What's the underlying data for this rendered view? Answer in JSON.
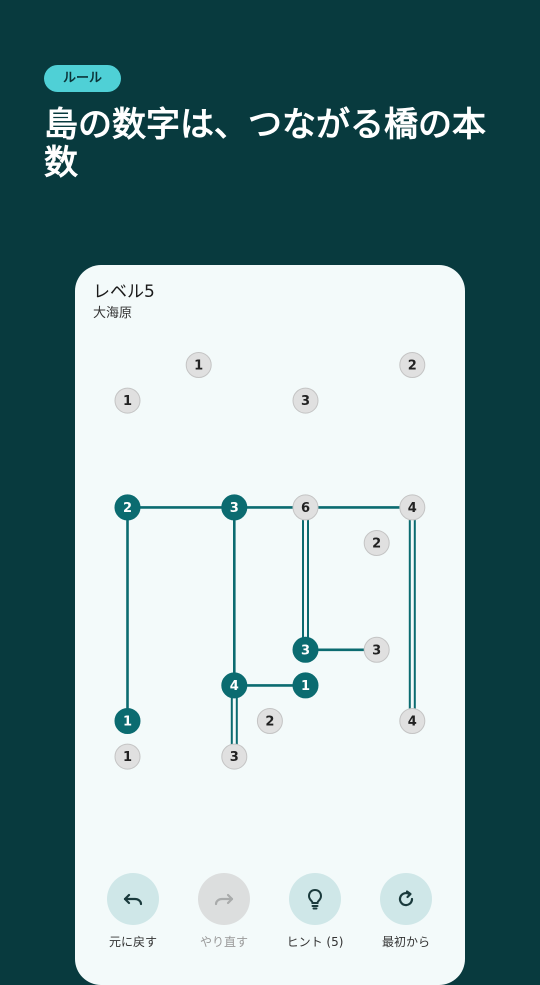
{
  "header": {
    "badge": "ルール",
    "headline": "島の数字は、つながる橋の本数"
  },
  "puzzle": {
    "level": "レベル5",
    "subtitle": "大海原",
    "colors": {
      "complete": "#0b6b70",
      "incomplete": "#e0e0e0",
      "bridge": "#0b6b70"
    },
    "islands": [
      {
        "id": "a",
        "col": 2,
        "row": 0,
        "n": "1",
        "state": "incomplete"
      },
      {
        "id": "b",
        "col": 8,
        "row": 0,
        "n": "2",
        "state": "incomplete"
      },
      {
        "id": "c",
        "col": 0,
        "row": 1,
        "n": "1",
        "state": "incomplete"
      },
      {
        "id": "d",
        "col": 5,
        "row": 1,
        "n": "3",
        "state": "incomplete"
      },
      {
        "id": "e",
        "col": 0,
        "row": 4,
        "n": "2",
        "state": "complete"
      },
      {
        "id": "f",
        "col": 3,
        "row": 4,
        "n": "3",
        "state": "complete"
      },
      {
        "id": "g",
        "col": 5,
        "row": 4,
        "n": "6",
        "state": "incomplete"
      },
      {
        "id": "h",
        "col": 8,
        "row": 4,
        "n": "4",
        "state": "incomplete"
      },
      {
        "id": "i",
        "col": 7,
        "row": 5,
        "n": "2",
        "state": "incomplete"
      },
      {
        "id": "j",
        "col": 5,
        "row": 8,
        "n": "3",
        "state": "complete"
      },
      {
        "id": "k",
        "col": 7,
        "row": 8,
        "n": "3",
        "state": "incomplete"
      },
      {
        "id": "l",
        "col": 3,
        "row": 9,
        "n": "4",
        "state": "complete"
      },
      {
        "id": "m",
        "col": 5,
        "row": 9,
        "n": "1",
        "state": "complete"
      },
      {
        "id": "n",
        "col": 0,
        "row": 10,
        "n": "1",
        "state": "complete"
      },
      {
        "id": "o",
        "col": 4,
        "row": 10,
        "n": "2",
        "state": "incomplete"
      },
      {
        "id": "p",
        "col": 8,
        "row": 10,
        "n": "4",
        "state": "incomplete"
      },
      {
        "id": "q",
        "col": 0,
        "row": 11,
        "n": "1",
        "state": "incomplete"
      },
      {
        "id": "r",
        "col": 3,
        "row": 11,
        "n": "3",
        "state": "incomplete"
      }
    ],
    "bridges": [
      {
        "from": "e",
        "to": "f",
        "count": 1
      },
      {
        "from": "f",
        "to": "g",
        "count": 1
      },
      {
        "from": "g",
        "to": "h",
        "count": 1
      },
      {
        "from": "e",
        "to": "n",
        "count": 1
      },
      {
        "from": "f",
        "to": "l",
        "count": 1
      },
      {
        "from": "g",
        "to": "j",
        "count": 2
      },
      {
        "from": "h",
        "to": "p",
        "count": 2
      },
      {
        "from": "j",
        "to": "k",
        "count": 1
      },
      {
        "from": "l",
        "to": "m",
        "count": 1
      },
      {
        "from": "l",
        "to": "r",
        "count": 2
      }
    ]
  },
  "toolbar": {
    "undo_label": "元に戻す",
    "redo_label": "やり直す",
    "hint_label": "ヒント (5)",
    "restart_label": "最初から"
  }
}
